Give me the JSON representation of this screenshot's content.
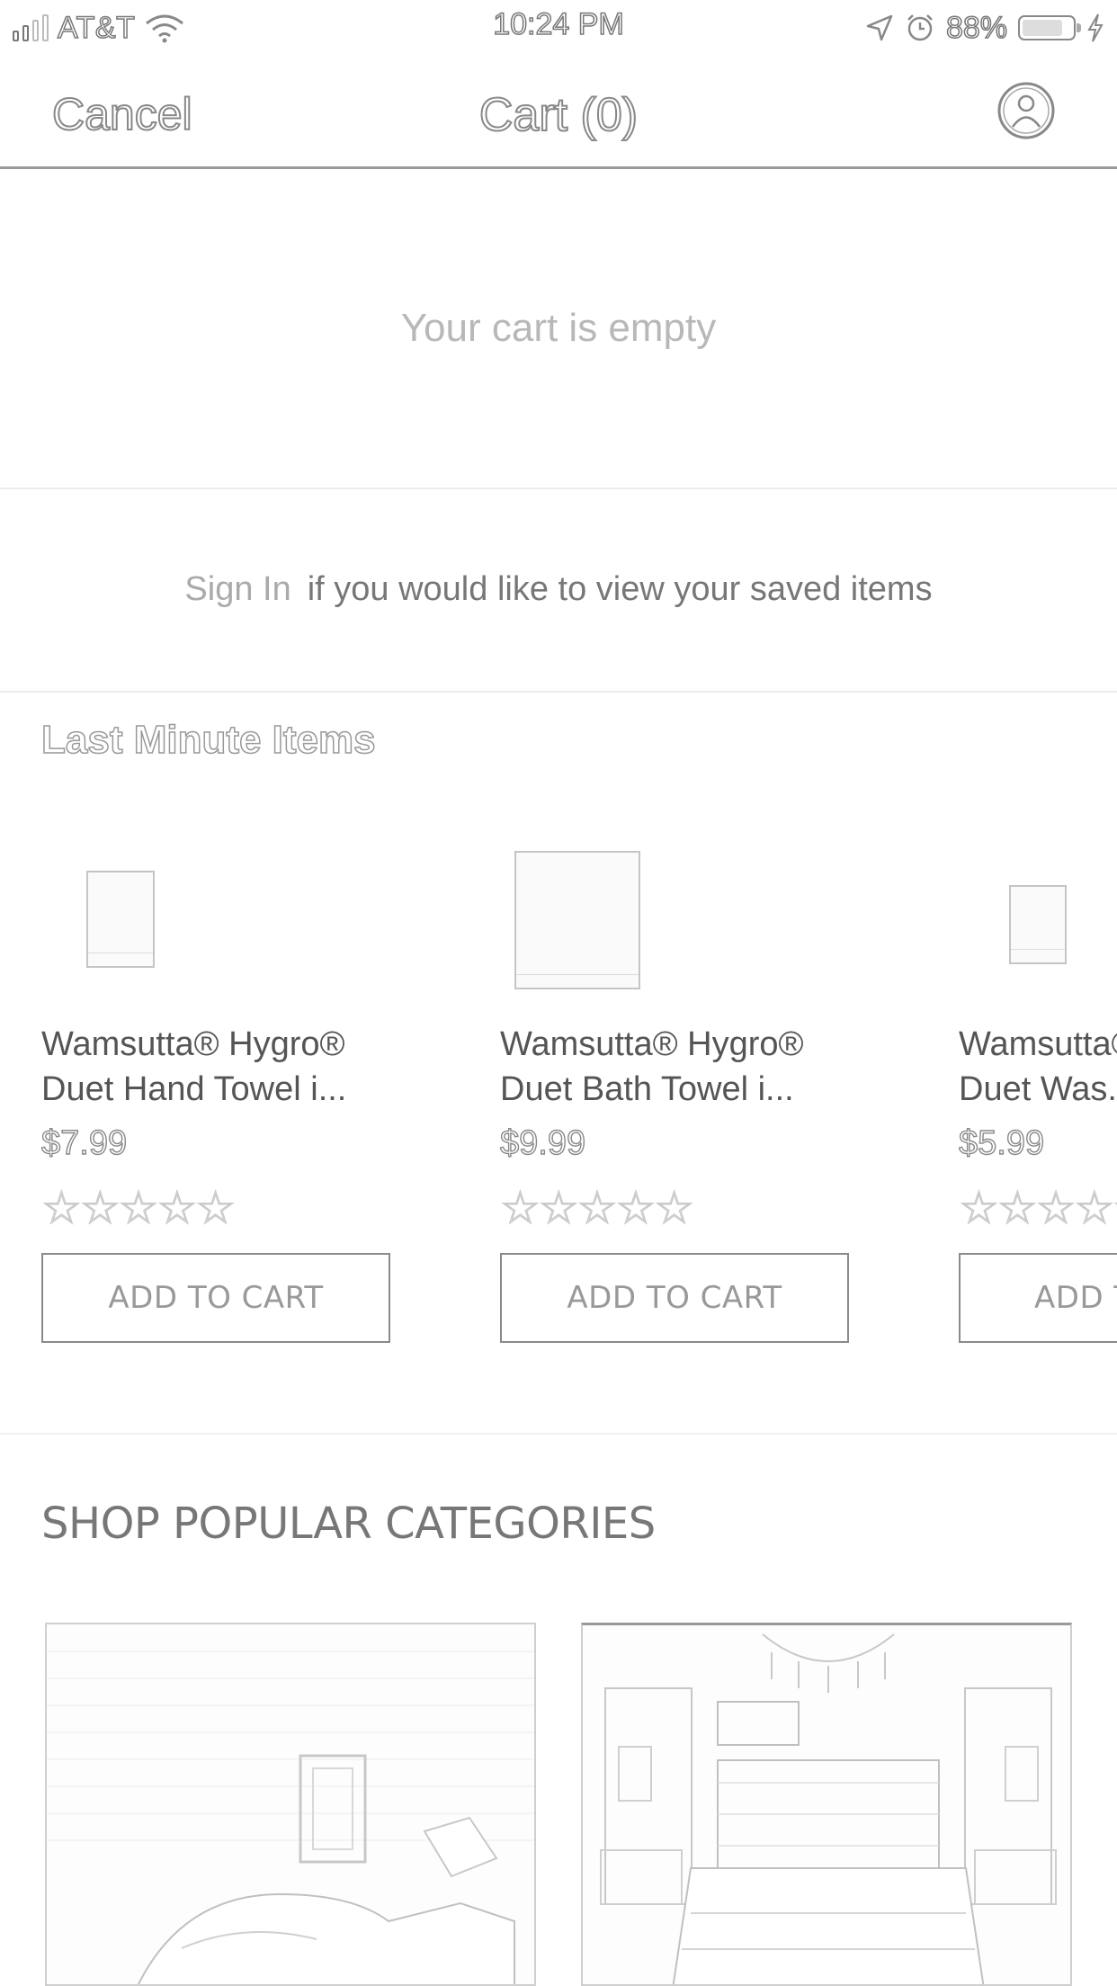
{
  "status_bar": {
    "carrier": "AT&T",
    "time": "10:24 PM",
    "battery_percent": "88%",
    "battery_level": 0.88,
    "icons": [
      "signal-icon",
      "wifi-icon",
      "location-icon",
      "alarm-icon",
      "battery-icon",
      "charging-icon"
    ]
  },
  "nav": {
    "cancel_label": "Cancel",
    "title": "Cart (0)",
    "account_icon": "account-icon"
  },
  "cart": {
    "empty_message": "Your cart is empty"
  },
  "signin": {
    "link_label": "Sign In",
    "message": "if you would like to view your saved items"
  },
  "last_minute": {
    "heading": "Last Minute Items",
    "products": [
      {
        "name_line1": "Wamsutta® Hygro®",
        "name_line2": "Duet Hand Towel i...",
        "price": "$7.99",
        "rating": 0,
        "stars": "☆☆☆☆☆",
        "button_label": "ADD TO CART"
      },
      {
        "name_line1": "Wamsutta® Hygro®",
        "name_line2": "Duet Bath Towel i...",
        "price": "$9.99",
        "rating": 0,
        "stars": "☆☆☆☆☆",
        "button_label": "ADD TO CART"
      },
      {
        "name_line1": "Wamsutta® Hygro®",
        "name_line2": "Duet Was...",
        "price": "$5.99",
        "rating": 0,
        "stars": "☆☆☆☆☆",
        "button_label": "ADD TO CART"
      }
    ]
  },
  "categories": {
    "heading": "SHOP POPULAR CATEGORIES",
    "tiles": [
      "category-tile-bedroom-image",
      "category-tile-bedding-image"
    ]
  }
}
